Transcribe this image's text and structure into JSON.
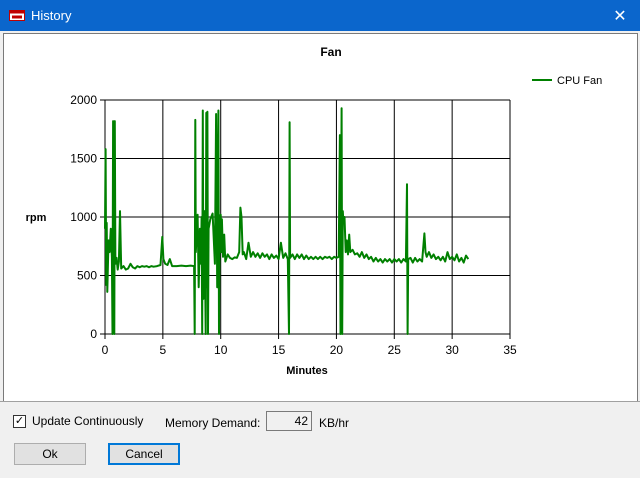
{
  "window": {
    "title": "History",
    "close_glyph": "✕"
  },
  "chart_data": {
    "type": "line",
    "title": "Fan",
    "xlabel": "Minutes",
    "ylabel": "rpm",
    "xlim": [
      0,
      35
    ],
    "ylim": [
      0,
      2000
    ],
    "xticks": [
      0,
      5,
      10,
      15,
      20,
      25,
      30,
      35
    ],
    "yticks": [
      0,
      500,
      1000,
      1500,
      2000
    ],
    "grid": true,
    "legend_position": "top-right",
    "series": [
      {
        "name": "CPU Fan",
        "color": "#008000",
        "points": [
          [
            0.0,
            900
          ],
          [
            0.05,
            1580
          ],
          [
            0.1,
            420
          ],
          [
            0.15,
            950
          ],
          [
            0.2,
            360
          ],
          [
            0.3,
            800
          ],
          [
            0.4,
            700
          ],
          [
            0.5,
            900
          ],
          [
            0.6,
            650
          ],
          [
            0.65,
            0
          ],
          [
            0.7,
            1820
          ],
          [
            0.75,
            1800
          ],
          [
            0.8,
            0
          ],
          [
            0.85,
            1820
          ],
          [
            0.9,
            600
          ],
          [
            1.0,
            650
          ],
          [
            1.1,
            550
          ],
          [
            1.2,
            620
          ],
          [
            1.3,
            1050
          ],
          [
            1.4,
            560
          ],
          [
            1.6,
            580
          ],
          [
            1.8,
            550
          ],
          [
            2.0,
            560
          ],
          [
            2.2,
            600
          ],
          [
            2.4,
            570
          ],
          [
            2.6,
            560
          ],
          [
            2.8,
            580
          ],
          [
            3.0,
            570
          ],
          [
            3.2,
            580
          ],
          [
            3.4,
            575
          ],
          [
            3.6,
            580
          ],
          [
            3.8,
            570
          ],
          [
            4.0,
            580
          ],
          [
            4.2,
            575
          ],
          [
            4.5,
            580
          ],
          [
            4.8,
            590
          ],
          [
            4.95,
            830
          ],
          [
            5.05,
            640
          ],
          [
            5.2,
            600
          ],
          [
            5.4,
            590
          ],
          [
            5.6,
            640
          ],
          [
            5.8,
            580
          ],
          [
            6.2,
            580
          ],
          [
            6.6,
            585
          ],
          [
            7.0,
            580
          ],
          [
            7.4,
            585
          ],
          [
            7.7,
            580
          ],
          [
            7.75,
            0
          ],
          [
            7.8,
            1830
          ],
          [
            7.85,
            700
          ],
          [
            8.0,
            1020
          ],
          [
            8.1,
            400
          ],
          [
            8.2,
            900
          ],
          [
            8.3,
            600
          ],
          [
            8.35,
            1000
          ],
          [
            8.4,
            0
          ],
          [
            8.45,
            1910
          ],
          [
            8.5,
            300
          ],
          [
            8.6,
            1050
          ],
          [
            8.7,
            0
          ],
          [
            8.75,
            1890
          ],
          [
            8.8,
            400
          ],
          [
            8.85,
            1900
          ],
          [
            8.9,
            0
          ],
          [
            8.95,
            900
          ],
          [
            9.1,
            980
          ],
          [
            9.3,
            1030
          ],
          [
            9.5,
            600
          ],
          [
            9.6,
            1880
          ],
          [
            9.7,
            400
          ],
          [
            9.8,
            1910
          ],
          [
            9.85,
            0
          ],
          [
            9.9,
            920
          ],
          [
            10.0,
            1020
          ],
          [
            10.05,
            700
          ],
          [
            10.1,
            980
          ],
          [
            10.2,
            660
          ],
          [
            10.3,
            850
          ],
          [
            10.4,
            620
          ],
          [
            10.6,
            680
          ],
          [
            10.8,
            650
          ],
          [
            11.0,
            640
          ],
          [
            11.2,
            655
          ],
          [
            11.4,
            650
          ],
          [
            11.6,
            700
          ],
          [
            11.7,
            1080
          ],
          [
            11.8,
            1000
          ],
          [
            11.9,
            680
          ],
          [
            12.0,
            700
          ],
          [
            12.2,
            640
          ],
          [
            12.4,
            780
          ],
          [
            12.6,
            660
          ],
          [
            12.8,
            700
          ],
          [
            13.0,
            660
          ],
          [
            13.2,
            690
          ],
          [
            13.4,
            650
          ],
          [
            13.6,
            690
          ],
          [
            13.8,
            660
          ],
          [
            14.0,
            680
          ],
          [
            14.2,
            640
          ],
          [
            14.4,
            680
          ],
          [
            14.6,
            650
          ],
          [
            14.8,
            670
          ],
          [
            15.0,
            640
          ],
          [
            15.2,
            780
          ],
          [
            15.4,
            650
          ],
          [
            15.6,
            690
          ],
          [
            15.8,
            640
          ],
          [
            15.9,
            0
          ],
          [
            15.95,
            1810
          ],
          [
            16.0,
            650
          ],
          [
            16.2,
            680
          ],
          [
            16.4,
            640
          ],
          [
            16.6,
            680
          ],
          [
            16.8,
            650
          ],
          [
            17.0,
            680
          ],
          [
            17.2,
            640
          ],
          [
            17.4,
            670
          ],
          [
            17.6,
            640
          ],
          [
            17.8,
            660
          ],
          [
            18.0,
            640
          ],
          [
            18.2,
            660
          ],
          [
            18.4,
            640
          ],
          [
            18.6,
            660
          ],
          [
            18.8,
            640
          ],
          [
            19.0,
            660
          ],
          [
            19.2,
            650
          ],
          [
            19.4,
            660
          ],
          [
            19.6,
            640
          ],
          [
            19.8,
            660
          ],
          [
            20.0,
            650
          ],
          [
            20.2,
            660
          ],
          [
            20.3,
            1700
          ],
          [
            20.35,
            0
          ],
          [
            20.45,
            1930
          ],
          [
            20.5,
            0
          ],
          [
            20.55,
            1050
          ],
          [
            20.6,
            950
          ],
          [
            20.7,
            1000
          ],
          [
            20.8,
            700
          ],
          [
            20.9,
            800
          ],
          [
            21.0,
            680
          ],
          [
            21.1,
            850
          ],
          [
            21.2,
            700
          ],
          [
            21.4,
            720
          ],
          [
            21.6,
            680
          ],
          [
            21.8,
            690
          ],
          [
            22.0,
            660
          ],
          [
            22.2,
            700
          ],
          [
            22.4,
            650
          ],
          [
            22.6,
            680
          ],
          [
            22.8,
            640
          ],
          [
            23.0,
            660
          ],
          [
            23.2,
            620
          ],
          [
            23.4,
            650
          ],
          [
            23.6,
            620
          ],
          [
            23.8,
            640
          ],
          [
            24.0,
            610
          ],
          [
            24.2,
            640
          ],
          [
            24.4,
            620
          ],
          [
            24.6,
            640
          ],
          [
            24.8,
            610
          ],
          [
            25.0,
            640
          ],
          [
            25.2,
            620
          ],
          [
            25.4,
            640
          ],
          [
            25.6,
            610
          ],
          [
            25.8,
            640
          ],
          [
            26.0,
            620
          ],
          [
            26.1,
            1280
          ],
          [
            26.15,
            0
          ],
          [
            26.2,
            640
          ],
          [
            26.4,
            650
          ],
          [
            26.6,
            610
          ],
          [
            26.8,
            650
          ],
          [
            27.0,
            620
          ],
          [
            27.2,
            640
          ],
          [
            27.4,
            620
          ],
          [
            27.6,
            860
          ],
          [
            27.7,
            700
          ],
          [
            27.8,
            660
          ],
          [
            28.0,
            700
          ],
          [
            28.2,
            650
          ],
          [
            28.4,
            680
          ],
          [
            28.6,
            640
          ],
          [
            28.8,
            660
          ],
          [
            29.0,
            630
          ],
          [
            29.2,
            660
          ],
          [
            29.4,
            620
          ],
          [
            29.6,
            700
          ],
          [
            29.8,
            640
          ],
          [
            30.0,
            660
          ],
          [
            30.2,
            630
          ],
          [
            30.4,
            680
          ],
          [
            30.6,
            620
          ],
          [
            30.8,
            650
          ],
          [
            31.0,
            610
          ],
          [
            31.2,
            670
          ],
          [
            31.4,
            640
          ]
        ]
      }
    ]
  },
  "controls": {
    "update_label": "Update Continuously",
    "update_checked": true,
    "check_glyph": "✓",
    "memory_label": "Memory Demand:",
    "memory_value": "42",
    "memory_unit": "KB/hr",
    "ok_label": "Ok",
    "cancel_label": "Cancel"
  }
}
